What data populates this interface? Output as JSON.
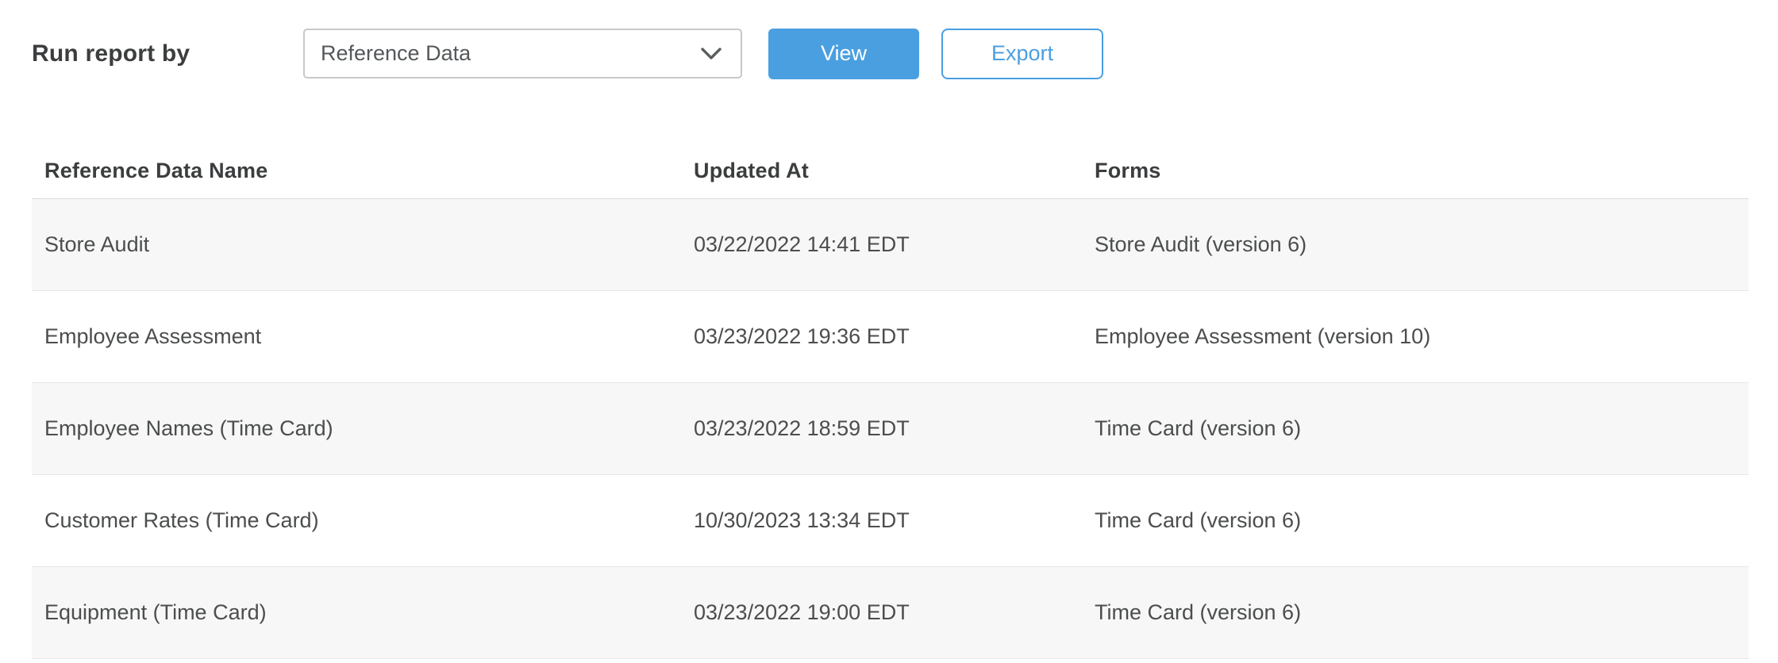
{
  "toolbar": {
    "label": "Run report by",
    "dropdown": {
      "selected": "Reference Data"
    },
    "view_label": "View",
    "export_label": "Export"
  },
  "table": {
    "columns": {
      "name": "Reference Data Name",
      "updated_at": "Updated At",
      "forms": "Forms"
    },
    "rows": [
      {
        "name": "Store Audit",
        "updated_at": "03/22/2022 14:41 EDT",
        "forms": "Store Audit (version 6)"
      },
      {
        "name": "Employee Assessment",
        "updated_at": "03/23/2022 19:36 EDT",
        "forms": "Employee Assessment (version 10)"
      },
      {
        "name": "Employee Names (Time Card)",
        "updated_at": "03/23/2022 18:59 EDT",
        "forms": "Time Card (version 6)"
      },
      {
        "name": "Customer Rates (Time Card)",
        "updated_at": "10/30/2023 13:34 EDT",
        "forms": "Time Card (version 6)"
      },
      {
        "name": "Equipment (Time Card)",
        "updated_at": "03/23/2022 19:00 EDT",
        "forms": "Time Card (version 6)"
      }
    ]
  },
  "icons": {
    "dropdown_chevron": "chevron-down-icon"
  },
  "colors": {
    "accent_blue": "#4a9fe0",
    "text_dark": "#3b3d3e",
    "text_row": "#4b4d4e",
    "row_alt_bg": "#f7f7f7",
    "row_border": "#e7e7e7",
    "dropdown_border": "#c8c8c8"
  }
}
